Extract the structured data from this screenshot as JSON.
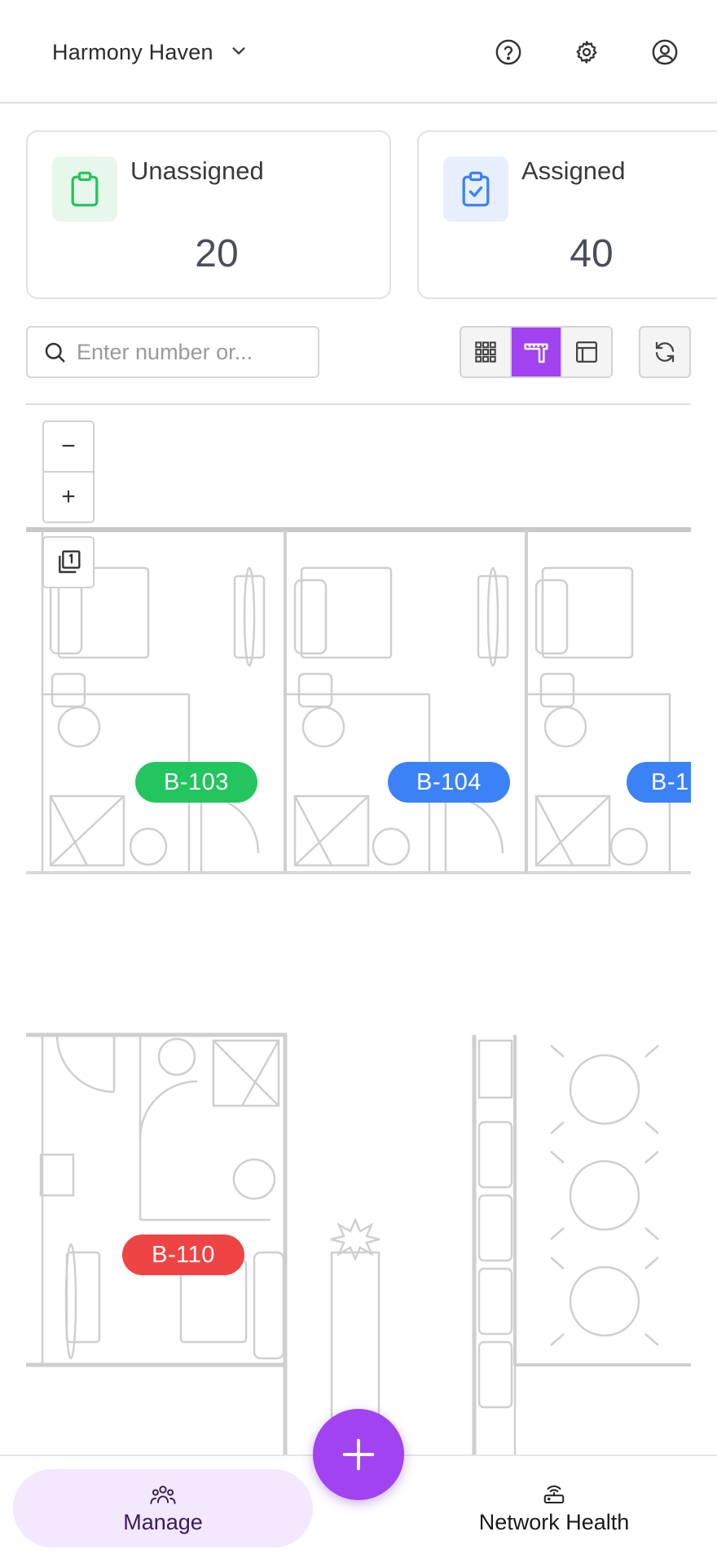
{
  "header": {
    "site_name": "Harmony Haven",
    "icons": [
      "chevron-down-icon",
      "help-icon",
      "gear-icon",
      "user-icon"
    ]
  },
  "cards": [
    {
      "label": "Unassigned",
      "count": "20",
      "icon": "clipboard-icon",
      "color": "#22c55e",
      "bg": "#e8f7ec"
    },
    {
      "label": "Assigned",
      "count": "40",
      "icon": "clipboard-check-icon",
      "color": "#3b82f6",
      "bg": "#e8effc"
    }
  ],
  "search": {
    "placeholder": "Enter number or..."
  },
  "view_modes": [
    {
      "name": "grid",
      "icon": "grid-icon",
      "active": false
    },
    {
      "name": "floor-plan",
      "icon": "floor-plan-icon",
      "active": true
    },
    {
      "name": "table",
      "icon": "table-layout-icon",
      "active": false
    }
  ],
  "map": {
    "zoom_out": "−",
    "zoom_in": "+",
    "rooms": [
      {
        "label": "B-103",
        "status": "unassigned",
        "color": "#22c55e"
      },
      {
        "label": "B-104",
        "status": "assigned",
        "color": "#3b82f6"
      },
      {
        "label": "B-1",
        "status": "assigned",
        "color": "#3b82f6"
      },
      {
        "label": "B-110",
        "status": "alert",
        "color": "#ef4444"
      }
    ]
  },
  "bottom_nav": {
    "manage": "Manage",
    "network_health": "Network Health"
  },
  "colors": {
    "accent": "#a243f2",
    "nav_active_bg": "#f3e8fd"
  }
}
